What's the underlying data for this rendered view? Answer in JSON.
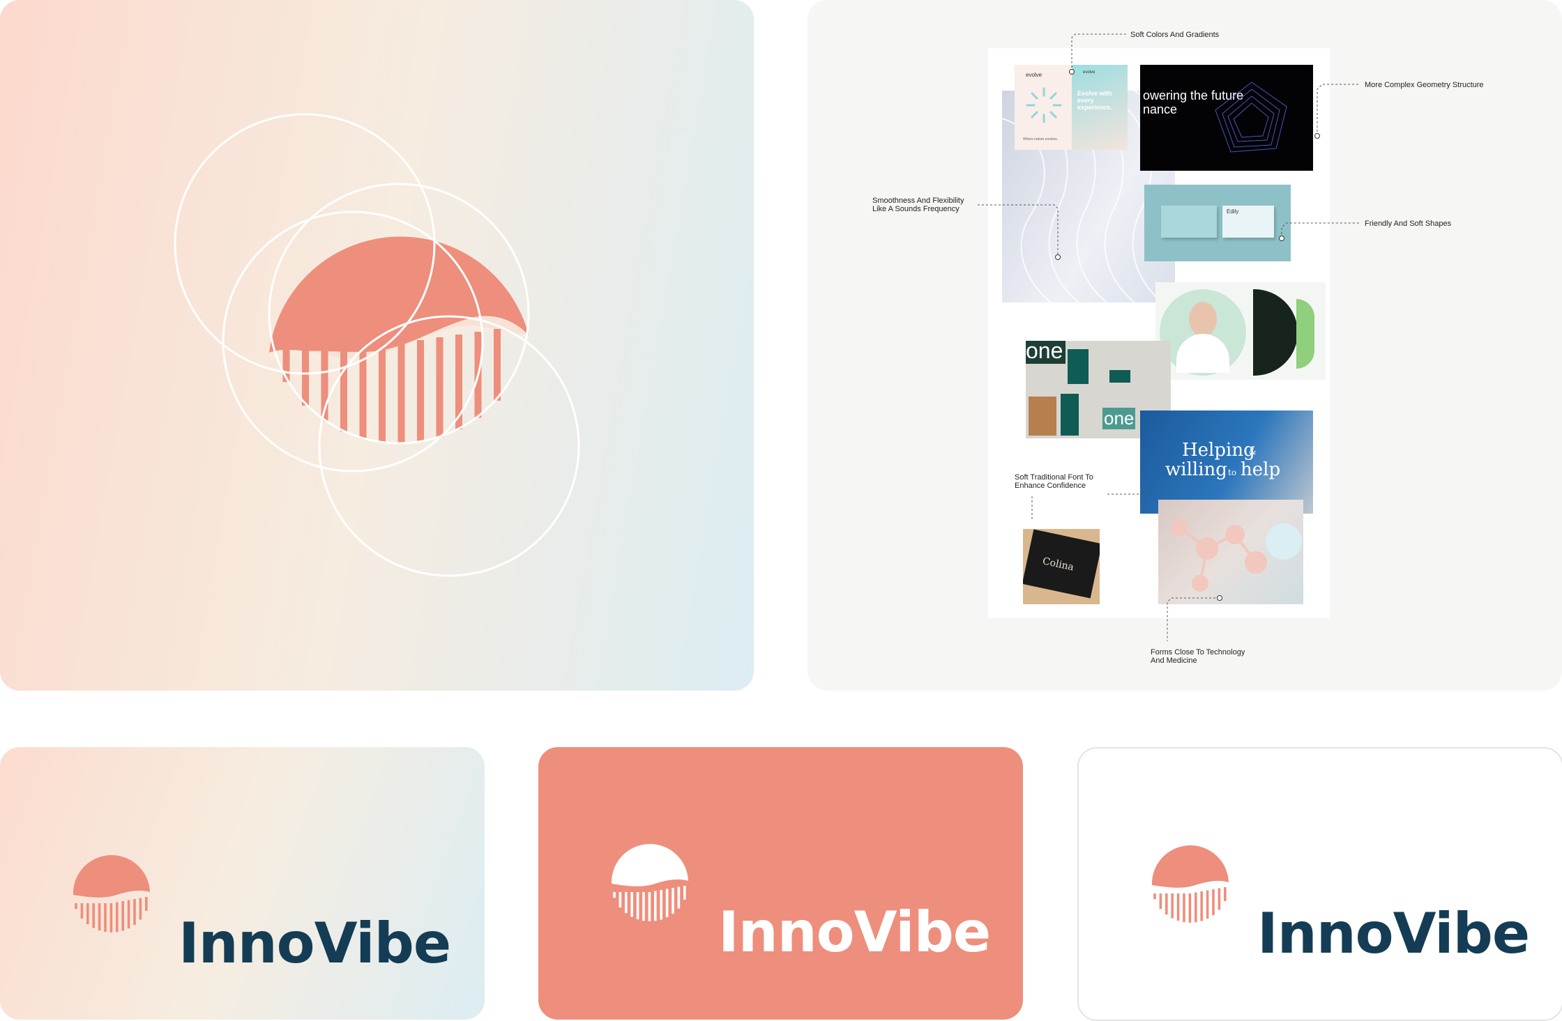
{
  "brand": {
    "name": "InnoVibe",
    "colors": {
      "coral": "#ee8e7c",
      "navy": "#143c55",
      "white": "#ffffff",
      "gradient_start": "#fcd9cd",
      "gradient_mid": "#f6ece0",
      "gradient_end": "#dcedf3"
    }
  },
  "construction": {
    "guides": "circle-guides",
    "mark": "innovibe-logomark"
  },
  "moodboard": {
    "annotations": {
      "soft_colors": "Soft Colors And Gradients",
      "geometry": "More Complex Geometry Structure",
      "smoothness": "Smoothness And Flexibility\nLike A Sounds Frequency",
      "friendly": "Friendly And Soft Shapes",
      "traditional_font": "Soft Traditional Font To\nEnhance Confidence",
      "forms": "Forms Close To Technology\nAnd Medicine"
    },
    "tiles": {
      "evolve_brand": "evolve",
      "evolve_brand_small": "evolve",
      "evolve_headline": "Evolve with\nevery\nexperience.",
      "evolve_footer": "Where nature evolves.",
      "dark_headline": "owering the future\nnance",
      "card_brand": "Edily",
      "one_word": "one",
      "one_word_2": "one",
      "helping_line1": "Helping",
      "helping_amp": "&",
      "helping_line2": "willing",
      "helping_to": "to",
      "helping_line3": "help",
      "colina": "Colina"
    }
  },
  "cards": [
    {
      "variant": "gradient",
      "logo_color": "#ee8e7c",
      "text_color": "#143c55"
    },
    {
      "variant": "coral",
      "logo_color": "#ffffff",
      "text_color": "#ffffff"
    },
    {
      "variant": "white",
      "logo_color": "#ee8e7c",
      "text_color": "#143c55"
    }
  ]
}
